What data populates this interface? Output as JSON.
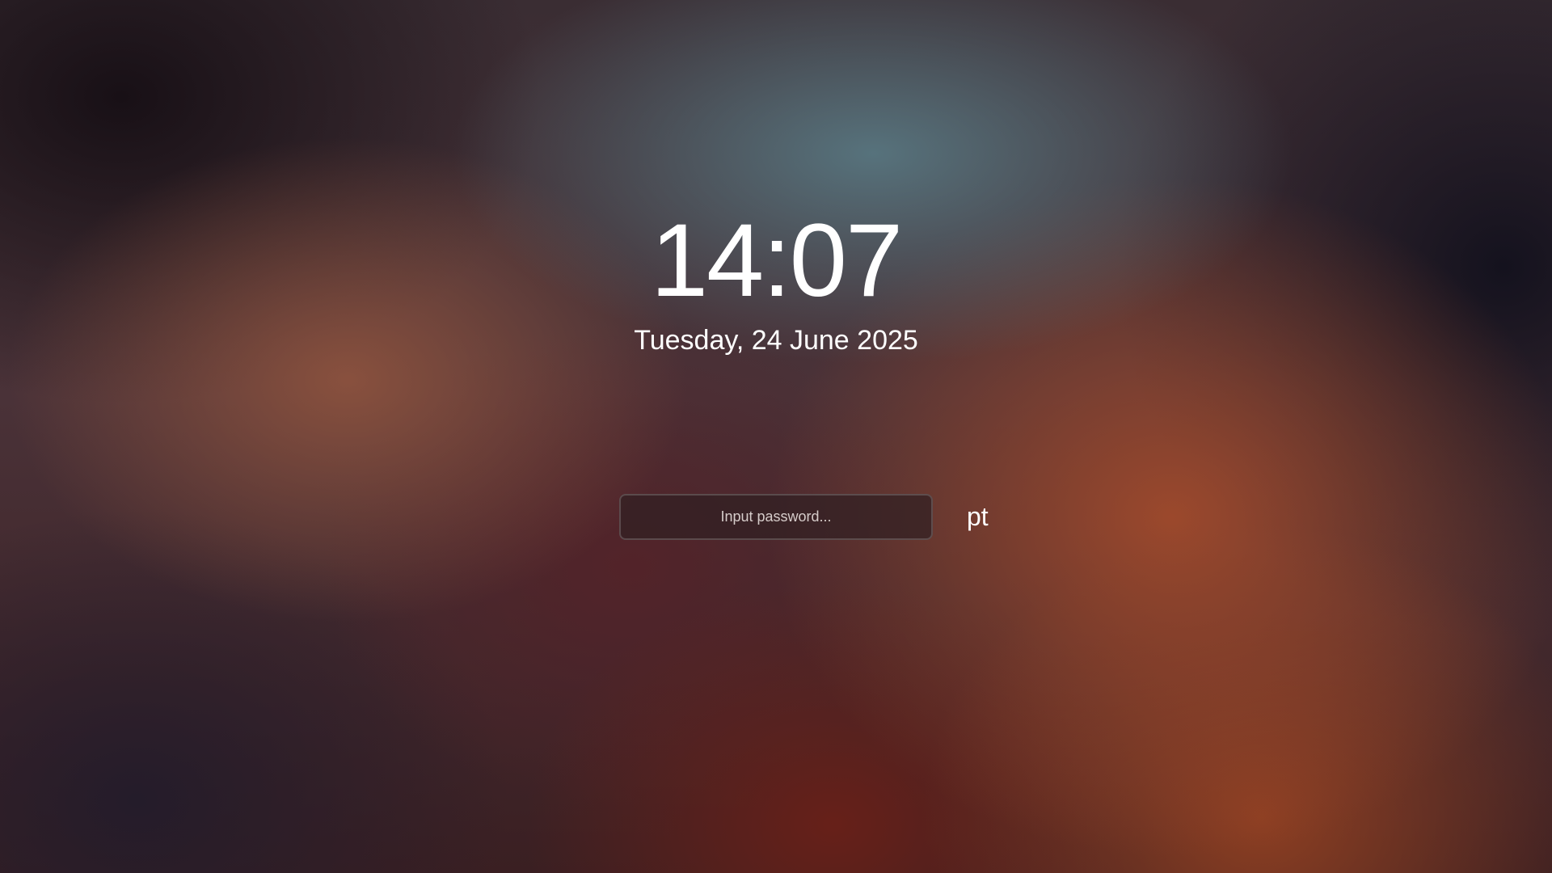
{
  "lock_screen": {
    "time": "14:07",
    "date": "Tuesday, 24 June 2025",
    "password": {
      "placeholder": "Input password...",
      "value": ""
    },
    "keyboard_layout": "pt"
  },
  "colors": {
    "text": "#ffffff",
    "input_background": "#30202380",
    "background_accent_warm": "#a04a2c",
    "background_accent_cool": "#587680"
  }
}
